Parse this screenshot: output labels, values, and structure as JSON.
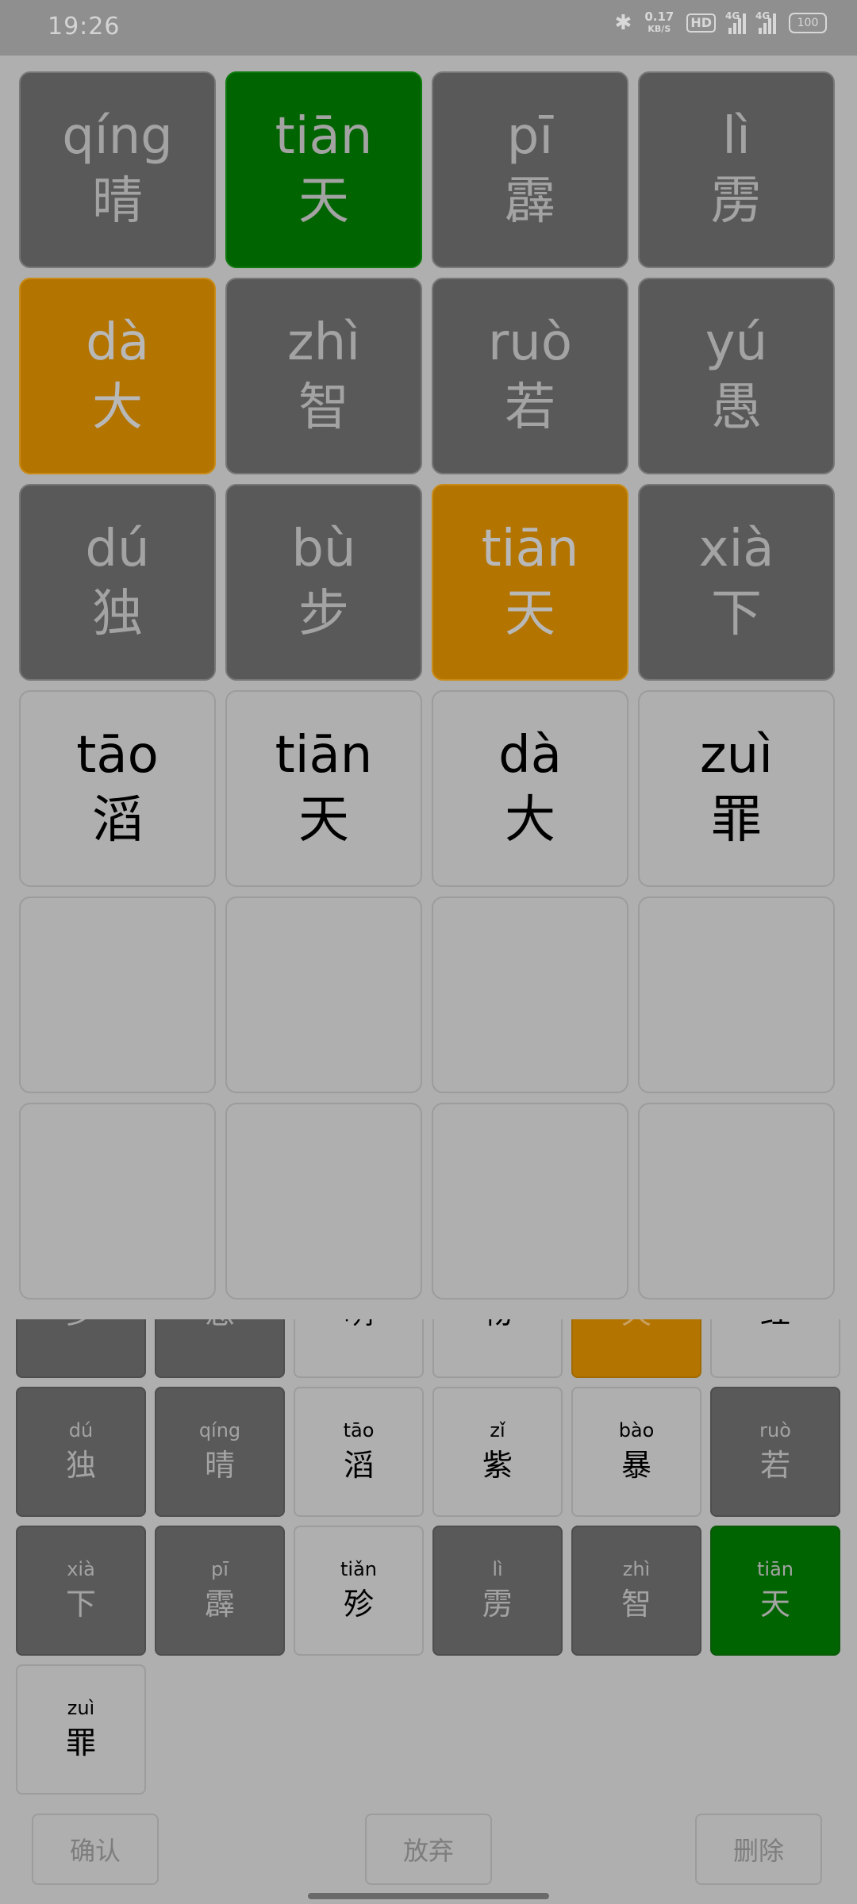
{
  "status_bar": {
    "time": "19:26",
    "speed_value": "0.17",
    "speed_unit": "KB/S",
    "hd_badge": "HD",
    "sim1_label": "4G",
    "sim2_label": "4G",
    "battery": "100"
  },
  "board": {
    "rows": [
      [
        {
          "py": "qíng",
          "hz": "晴",
          "state": "gray"
        },
        {
          "py": "tiān",
          "hz": "天",
          "state": "green"
        },
        {
          "py": "pī",
          "hz": "霹",
          "state": "gray"
        },
        {
          "py": "lì",
          "hz": "雳",
          "state": "gray"
        }
      ],
      [
        {
          "py": "dà",
          "hz": "大",
          "state": "orange"
        },
        {
          "py": "zhì",
          "hz": "智",
          "state": "gray"
        },
        {
          "py": "ruò",
          "hz": "若",
          "state": "gray"
        },
        {
          "py": "yú",
          "hz": "愚",
          "state": "gray"
        }
      ],
      [
        {
          "py": "dú",
          "hz": "独",
          "state": "gray"
        },
        {
          "py": "bù",
          "hz": "步",
          "state": "gray"
        },
        {
          "py": "tiān",
          "hz": "天",
          "state": "orange"
        },
        {
          "py": "xià",
          "hz": "下",
          "state": "gray"
        }
      ],
      [
        {
          "py": "tāo",
          "hz": "滔",
          "state": "light"
        },
        {
          "py": "tiān",
          "hz": "天",
          "state": "light"
        },
        {
          "py": "dà",
          "hz": "大",
          "state": "light"
        },
        {
          "py": "zuì",
          "hz": "罪",
          "state": "light"
        }
      ]
    ],
    "empty_rows": 2
  },
  "keyboard": {
    "keys": [
      {
        "py": "",
        "hz": "步",
        "state": "gray"
      },
      {
        "py": "",
        "hz": "愚",
        "state": "gray"
      },
      {
        "py": "",
        "hz": "咧",
        "state": "light"
      },
      {
        "py": "",
        "hz": "物",
        "state": "light"
      },
      {
        "py": "",
        "hz": "天",
        "state": "orange"
      },
      {
        "py": "",
        "hz": "红",
        "state": "light"
      },
      {
        "py": "dú",
        "hz": "独",
        "state": "gray"
      },
      {
        "py": "qíng",
        "hz": "晴",
        "state": "gray"
      },
      {
        "py": "tāo",
        "hz": "滔",
        "state": "light"
      },
      {
        "py": "zǐ",
        "hz": "紫",
        "state": "light"
      },
      {
        "py": "bào",
        "hz": "暴",
        "state": "light"
      },
      {
        "py": "ruò",
        "hz": "若",
        "state": "gray"
      },
      {
        "py": "xià",
        "hz": "下",
        "state": "gray"
      },
      {
        "py": "pī",
        "hz": "霹",
        "state": "gray"
      },
      {
        "py": "tiǎn",
        "hz": "殄",
        "state": "light"
      },
      {
        "py": "lì",
        "hz": "雳",
        "state": "gray"
      },
      {
        "py": "zhì",
        "hz": "智",
        "state": "gray"
      },
      {
        "py": "tiān",
        "hz": "天",
        "state": "green"
      },
      {
        "py": "zuì",
        "hz": "罪",
        "state": "light"
      }
    ]
  },
  "actions": {
    "confirm_label": "确认",
    "give_up_label": "放弃",
    "delete_label": "删除"
  },
  "colors": {
    "correct": "#006400",
    "misplaced": "#b37400",
    "absent": "#595959",
    "background": "#afafaf"
  }
}
